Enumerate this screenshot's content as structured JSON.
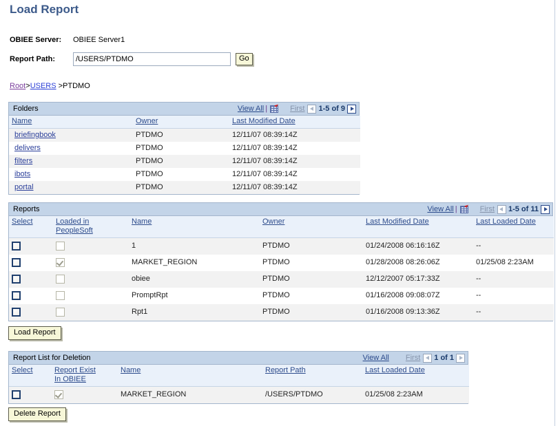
{
  "page": {
    "title": "Load Report"
  },
  "form": {
    "server_label": "OBIEE Server:",
    "server_value": "OBIEE Server1",
    "path_label": "Report Path:",
    "path_value": "/USERS/PTDMO",
    "go_label": "Go"
  },
  "breadcrumb": {
    "root": "Root",
    "sep1": ">",
    "users": "USERS",
    "sep2": ">",
    "current": "PTDMO"
  },
  "folders": {
    "title": "Folders",
    "nav": {
      "view_all": "View All",
      "first": "First",
      "count": "1-5 of 9",
      "grid_icon": "spreadsheet-download-icon"
    },
    "columns": [
      "Name",
      "Owner",
      "Last Modified Date"
    ],
    "rows": [
      {
        "name": "briefingbook",
        "owner": "PTDMO",
        "modified": "12/11/07 08:39:14Z"
      },
      {
        "name": "delivers",
        "owner": "PTDMO",
        "modified": "12/11/07 08:39:14Z"
      },
      {
        "name": "filters",
        "owner": "PTDMO",
        "modified": "12/11/07 08:39:14Z"
      },
      {
        "name": "ibots",
        "owner": "PTDMO",
        "modified": "12/11/07 08:39:14Z"
      },
      {
        "name": "portal",
        "owner": "PTDMO",
        "modified": "12/11/07 08:39:14Z"
      }
    ]
  },
  "reports": {
    "title": "Reports",
    "nav": {
      "view_all": "View All",
      "first": "First",
      "count": "1-5 of 11",
      "grid_icon": "spreadsheet-download-icon"
    },
    "columns": [
      "Select",
      "Loaded in PeopleSoft",
      "Name",
      "Owner",
      "Last Modified Date",
      "Last Loaded Date"
    ],
    "columns_split": {
      "loaded_line1": "Loaded in",
      "loaded_line2": "PeopleSoft"
    },
    "rows": [
      {
        "select": false,
        "loaded": false,
        "name": "1",
        "owner": "PTDMO",
        "modified": "01/24/2008 06:16:16Z",
        "loaded_date": "--"
      },
      {
        "select": false,
        "loaded": true,
        "name": "MARKET_REGION",
        "owner": "PTDMO",
        "modified": "01/28/2008 08:26:06Z",
        "loaded_date": "01/25/08  2:23AM"
      },
      {
        "select": false,
        "loaded": false,
        "name": "obiee",
        "owner": "PTDMO",
        "modified": "12/12/2007 05:17:33Z",
        "loaded_date": "--"
      },
      {
        "select": false,
        "loaded": false,
        "name": "PromptRpt",
        "owner": "PTDMO",
        "modified": "01/16/2008 09:08:07Z",
        "loaded_date": "--"
      },
      {
        "select": false,
        "loaded": false,
        "name": "Rpt1",
        "owner": "PTDMO",
        "modified": "01/16/2008 09:13:36Z",
        "loaded_date": "--"
      }
    ],
    "load_button": "Load Report"
  },
  "deletion": {
    "title": "Report List for Deletion",
    "nav": {
      "view_all": "View All",
      "first": "First",
      "count": "1 of 1"
    },
    "columns": [
      "Select",
      "Report Exist In OBIEE",
      "Name",
      "Report Path",
      "Last Loaded Date"
    ],
    "columns_split": {
      "exist_line1": "Report Exist",
      "exist_line2": "In OBIEE"
    },
    "rows": [
      {
        "select": false,
        "exists": true,
        "name": "MARKET_REGION",
        "path": "/USERS/PTDMO",
        "loaded_date": "01/25/08  2:23AM"
      }
    ],
    "delete_button": "Delete Report"
  },
  "colors": {
    "title": "#3c5a8a",
    "grid_header": "#c3d4e8",
    "column_header": "#eaf1fa",
    "link": "#2b4a8b",
    "button_face": "#f7f7d8"
  }
}
